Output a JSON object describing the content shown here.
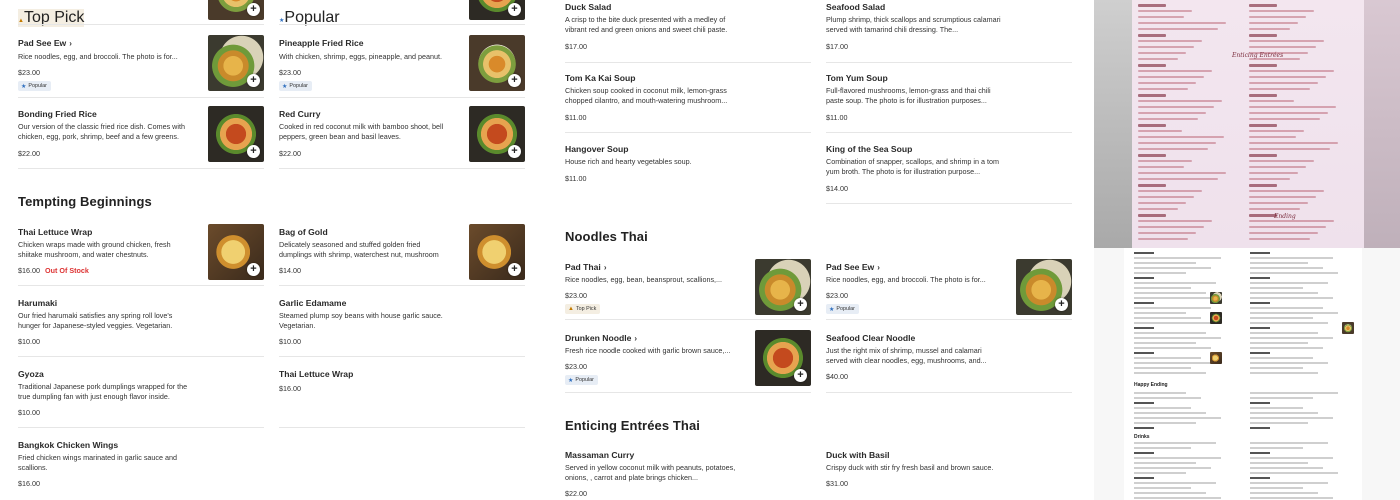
{
  "badges": {
    "popular": "Popular",
    "top_pick": "Top Pick"
  },
  "col1": {
    "top_badge": "Top Pick",
    "items": [
      {
        "name": "Pad See Ew",
        "desc": "Rice noodles, egg, and broccoli. The photo is for...",
        "price": "$23.00",
        "badge": "Popular"
      },
      {
        "name": "Bonding Fried Rice",
        "desc": "Our version of the classic fried rice dish. Comes with chicken, egg, pork, shrimp, beef and a few greens.",
        "price": "$22.00"
      }
    ],
    "section_title": "Tempting Beginnings",
    "items2": [
      {
        "name": "Thai Lettuce Wrap",
        "desc": "Chicken wraps made with ground chicken, fresh shiitake mushroom, and water chestnuts.",
        "price": "$16.00",
        "status": "Out Of Stock"
      },
      {
        "name": "Harumaki",
        "desc": "Our fried harumaki satisfies any spring roll love's hunger for Japanese-styled veggies. Vegetarian.",
        "price": "$10.00"
      },
      {
        "name": "Gyoza",
        "desc": "Traditional Japanese pork dumplings wrapped for the true dumpling fan with just enough flavor inside.",
        "price": "$10.00"
      },
      {
        "name": "Bangkok Chicken Wings",
        "desc": "Fried chicken wings marinated in garlic sauce and scallions.",
        "price": "$16.00"
      }
    ]
  },
  "col2": {
    "top_badge": "Popular",
    "items": [
      {
        "name": "Pineapple Fried Rice",
        "desc": "With chicken, shrimp, eggs, pineapple, and peanut.",
        "price": "$23.00",
        "badge": "Popular"
      },
      {
        "name": "Red Curry",
        "desc": "Cooked in red coconut milk with bamboo shoot, bell peppers, green bean and basil leaves.",
        "price": "$22.00"
      }
    ],
    "items2": [
      {
        "name": "Bag of Gold",
        "desc": "Delicately seasoned and stuffed golden fried dumplings with shrimp, waterchest nut, mushroom",
        "price": "$14.00"
      },
      {
        "name": "Garlic Edamame",
        "desc": "Steamed plump soy beans with house garlic sauce. Vegetarian.",
        "price": "$10.00"
      },
      {
        "name": "Thai Lettuce Wrap",
        "desc": "",
        "price": "$16.00"
      }
    ]
  },
  "col3": {
    "items": [
      {
        "name": "Duck Salad",
        "desc": "A crisp to the bite duck presented with a medley of vibrant red and green onions and sweet chili paste.",
        "price": "$17.00"
      },
      {
        "name": "Tom Ka Kai Soup",
        "desc": "Chicken soup cooked in coconut milk, lemon-grass chopped cilantro, and mouth-watering mushroom...",
        "price": "$11.00"
      },
      {
        "name": "Hangover Soup",
        "desc": "House rich and hearty vegetables soup.",
        "price": "$11.00"
      }
    ],
    "section_title": "Noodles Thai",
    "items2": [
      {
        "name": "Pad Thai",
        "desc": "Rice noodles, egg, bean, beansprout, scallions,...",
        "price": "$23.00",
        "badge": "Top Pick"
      },
      {
        "name": "Drunken Noodle",
        "desc": "Fresh rice noodle cooked with garlic brown sauce,...",
        "price": "$23.00",
        "badge": "Popular"
      }
    ],
    "section_title2": "Enticing Entrées Thai",
    "items3": [
      {
        "name": "Massaman Curry",
        "desc": "Served in yellow coconut milk with peanuts, potatoes, onions, , carrot and plate brings chicken...",
        "price": "$22.00"
      }
    ]
  },
  "col4": {
    "items": [
      {
        "name": "Seafood Salad",
        "desc": "Plump shrimp, thick scallops and scrumptious calamari served with tamarind chili dressing. The...",
        "price": "$17.00"
      },
      {
        "name": "Tom Yum Soup",
        "desc": "Full-flavored mushrooms, lemon-grass and thai chili paste soup. The photo is for illustration purposes...",
        "price": "$11.00"
      },
      {
        "name": "King of the Sea Soup",
        "desc": "Combination of snapper, scallops, and shrimp in a tom yum broth. The photo is for illustration purpose...",
        "price": "$14.00"
      }
    ],
    "items2": [
      {
        "name": "Pad See Ew",
        "desc": "Rice noodles, egg, and broccoli. The photo is for...",
        "price": "$23.00",
        "badge": "Popular"
      },
      {
        "name": "Seafood Clear Noodle",
        "desc": "Just the right mix of shrimp, mussel and calamari served with clear noodles, egg, mushrooms, and...",
        "price": "$40.00"
      }
    ],
    "items3": [
      {
        "name": "Duck with Basil",
        "desc": "Crispy duck with stir fry fresh basil and brown sauce.",
        "price": "$31.00"
      }
    ]
  },
  "menu_photo": {
    "script_1": "Enticing Entrées",
    "script_2": "Ending",
    "headings": [
      "Happy Ending",
      "Drinks"
    ]
  }
}
